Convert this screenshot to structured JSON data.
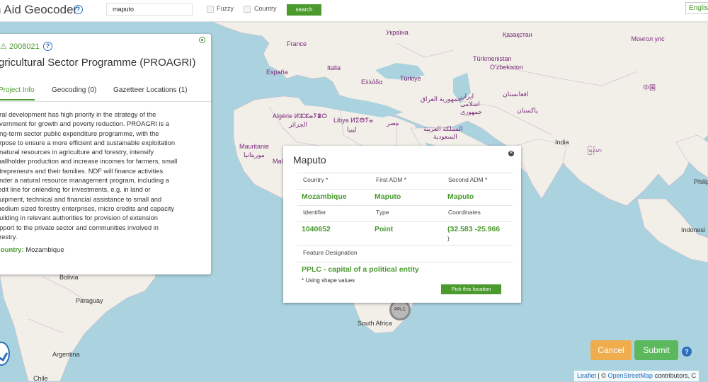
{
  "header": {
    "app_title": "n Aid Geocoder",
    "search_value": "maputo",
    "fuzzy_label": "Fuzzy",
    "country_label": "Country",
    "search_button": "search",
    "language": "Englis"
  },
  "project": {
    "id": "2008021",
    "title": "gricultural Sector Programme (PROAGRI)",
    "tabs": [
      "Project Info",
      "Geocoding (0)",
      "Gazetteer Locations (1)"
    ],
    "description_lines": [
      "ural development has high priority in the strategy of the",
      "overnment for growth and poverty reduction. PROAGRI is a",
      "ong-term sector public expenditure programme, with the",
      "urpose to ensure a more efficient and sustainable exploitation",
      "f natural resources in agriculture and forestry, intensify",
      "mallholder production and increase incomes for farmers, small",
      "ntrepreneurs and their families. NDF will finance activities",
      "under a natural resource management program, including a",
      "redit line for onlending for investments, e.g. in land or",
      "quipment, technical and financial assistance to small and",
      "medium sized forestry enterprises, micro credits and capacity",
      "building in relevant authorities for provision of extension",
      "upport to the private sector and communities involved in",
      "orestry."
    ],
    "country_label": "Country:",
    "country_value": "Mozambique"
  },
  "popup": {
    "title": "Maputo",
    "headers1": [
      "Country *",
      "First ADM *",
      "Second ADM *"
    ],
    "values1": [
      "Mozambique",
      "Maputo",
      "Maputo"
    ],
    "headers2": [
      "Identifier",
      "Type",
      "Coordinates"
    ],
    "values2": [
      "1040652",
      "Point",
      "(32.583 -25.966"
    ],
    "coord_tail": ")",
    "feature_label": "Feature Designation",
    "feature_value": "PPLC - capital of a political entity",
    "note": "* Using shape values",
    "pick_button": "Pick this location"
  },
  "marker_label": "PPLC",
  "buttons": {
    "cancel": "Cancel",
    "submit": "Submit"
  },
  "attribution": {
    "leaflet": "Leaflet",
    "sep": " | © ",
    "osm": "OpenStreetMap",
    "rest": " contributors, C"
  },
  "map_labels": {
    "ukraine": "Україна",
    "kazakhstan": "Қазақстан",
    "mongolia": "Монгол улс",
    "france": "France",
    "espana": "España",
    "italia": "Italia",
    "ellada": "Ελλάδα",
    "turkiye": "Türkiye",
    "turkmenistan": "Türkmenistan",
    "uzbekistan": "O'zbekiston",
    "china": "中国",
    "iraq": "جمهورية العراق",
    "iran": "ایران اسلامی جمهوری",
    "afghanistan": "افغانستان",
    "pakistan": "پاکستان",
    "algerie": "Algérie ⵍⵣⵣⴰⵢⴻⵔ",
    "algerie2": "الجزائر",
    "libya": "Libya ⵍⵉⴱⵢⴰ",
    "libya2": "ليبيا",
    "egypt": "مصر",
    "saudi": "المملكة العربية",
    "saudi2": "السعودية",
    "india": "India",
    "myanmar": "မြန်မာ",
    "mauritanie": "Mauritanie",
    "mauritanie2": "موريتانيا",
    "mali": "Mali",
    "bolivia": "Bolivia",
    "paraguay": "Paraguay",
    "argentina": "Argentina",
    "south_africa": "South Africa",
    "philippines": "Philip",
    "indonesia": "Indonesi",
    "chile": "Chile"
  }
}
